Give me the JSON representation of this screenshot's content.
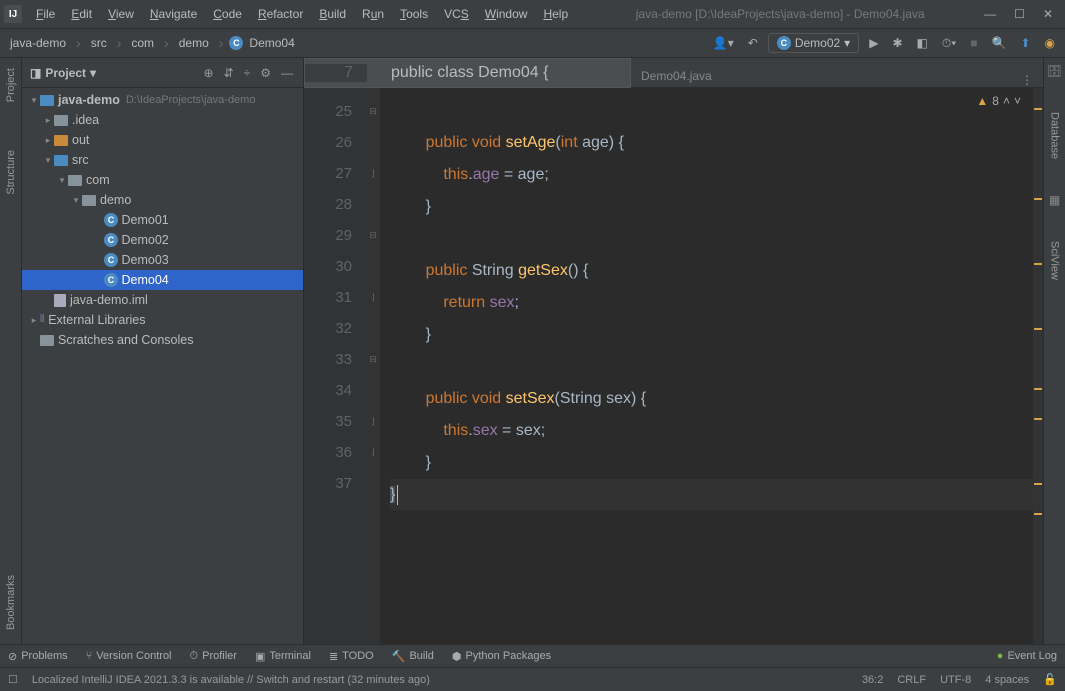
{
  "title": "java-demo [D:\\IdeaProjects\\java-demo] - Demo04.java",
  "menu": [
    "File",
    "Edit",
    "View",
    "Navigate",
    "Code",
    "Refactor",
    "Build",
    "Run",
    "Tools",
    "VCS",
    "Window",
    "Help"
  ],
  "breadcrumb": [
    "java-demo",
    "src",
    "com",
    "demo",
    "Demo04"
  ],
  "run_config": "Demo02",
  "project_panel": {
    "title": "Project",
    "root": "java-demo",
    "root_path": "D:\\IdeaProjects\\java-demo",
    "idea_folder": ".idea",
    "out_folder": "out",
    "src_folder": "src",
    "pkg_com": "com",
    "pkg_demo": "demo",
    "files": [
      "Demo01",
      "Demo02",
      "Demo03",
      "Demo04"
    ],
    "iml": "java-demo.iml",
    "ext_lib": "External Libraries",
    "scratches": "Scratches and Consoles"
  },
  "editor_tab": "Demo04.java",
  "sticky_line": "7",
  "sticky_code_kw1": "public",
  "sticky_code_kw2": "class",
  "sticky_code_cls": "Demo04",
  "sticky_code_brace": "{",
  "lines": [
    "25",
    "26",
    "27",
    "28",
    "29",
    "30",
    "31",
    "32",
    "33",
    "34",
    "35",
    "36",
    "37"
  ],
  "code_rows": {
    "r25": {
      "indent": "        ",
      "kw": "public void ",
      "method": "setAge",
      "sig": "(",
      "t": "int ",
      "p": "age",
      "close": ") {"
    },
    "r26": {
      "indent": "            ",
      "kw": "this",
      "dot": ".",
      "f": "age",
      "rest": " = age;"
    },
    "r27": {
      "indent": "        ",
      "b": "}"
    },
    "r29": {
      "indent": "        ",
      "kw": "public ",
      "t": "String ",
      "method": "getSex",
      "sig": "() {"
    },
    "r30": {
      "indent": "            ",
      "kw": "return ",
      "f": "sex",
      "semi": ";"
    },
    "r31": {
      "indent": "        ",
      "b": "}"
    },
    "r33": {
      "indent": "        ",
      "kw": "public void ",
      "method": "setSex",
      "sig": "(",
      "t": "String ",
      "p": "sex",
      "close": ") {"
    },
    "r34": {
      "indent": "            ",
      "kw": "this",
      "dot": ".",
      "f": "sex",
      "rest": " = sex;"
    },
    "r35": {
      "indent": "        ",
      "b": "}"
    },
    "r36": {
      "indent": "",
      "b": "}"
    }
  },
  "inspection_count": "8",
  "bottom": {
    "problems": "Problems",
    "vcs": "Version Control",
    "profiler": "Profiler",
    "terminal": "Terminal",
    "todo": "TODO",
    "build": "Build",
    "python": "Python Packages",
    "event": "Event Log"
  },
  "status": {
    "msg": "Localized IntelliJ IDEA 2021.3.3 is available // Switch and restart (32 minutes ago)",
    "pos": "36:2",
    "eol": "CRLF",
    "enc": "UTF-8",
    "indent": "4 spaces"
  },
  "left_tabs": [
    "Project",
    "Structure",
    "Bookmarks"
  ],
  "right_tabs": [
    "Database",
    "SciView"
  ]
}
